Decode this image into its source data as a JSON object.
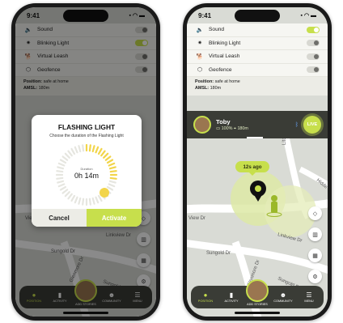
{
  "status_left": {
    "time": "9:41"
  },
  "status_right": {
    "time": "9:41"
  },
  "settings": [
    {
      "icon": "speaker-icon",
      "glyph": "🔈",
      "label": "Sound"
    },
    {
      "icon": "sun-icon",
      "glyph": "✷",
      "label": "Blinking Light"
    },
    {
      "icon": "dog-icon",
      "glyph": "🐕",
      "label": "Virtual Leash"
    },
    {
      "icon": "geofence-icon",
      "glyph": "⬡",
      "label": "Geofence"
    }
  ],
  "position": {
    "position_label": "Position:",
    "position_value": "safe at home",
    "amsl_label": "AMSL:",
    "amsl_value": "180m"
  },
  "pet": {
    "name": "Toby",
    "battery": "100%",
    "distance": "180m",
    "live_label": "LIVE"
  },
  "map": {
    "time_badge": "12s ago",
    "streets": [
      "Litchfield",
      "View Dr",
      "Linkview Dr",
      "Sungold Dr",
      "Glenmore Dr",
      "Sungold Dr",
      "Hidde"
    ],
    "left_streets": [
      "View Dr",
      "Linkview Dr",
      "Sungold Dr",
      "Glenmore Dr",
      "Sungold Dr"
    ]
  },
  "nav": {
    "position": "POSITION",
    "activity": "ACTIVITY",
    "add_stories": "ADD STORIES",
    "community": "COMMUNITY",
    "menu": "MENU"
  },
  "modal": {
    "title": "FLASHING LIGHT",
    "subtitle": "Choose the duration of the Flashing Light",
    "duration_label": "Duration",
    "duration_value": "0h 14m",
    "cancel": "Cancel",
    "activate": "Activate"
  },
  "colors": {
    "accent": "#c7df4c",
    "dark_bar": "#3a3c36",
    "panel": "#f6f6f2"
  }
}
